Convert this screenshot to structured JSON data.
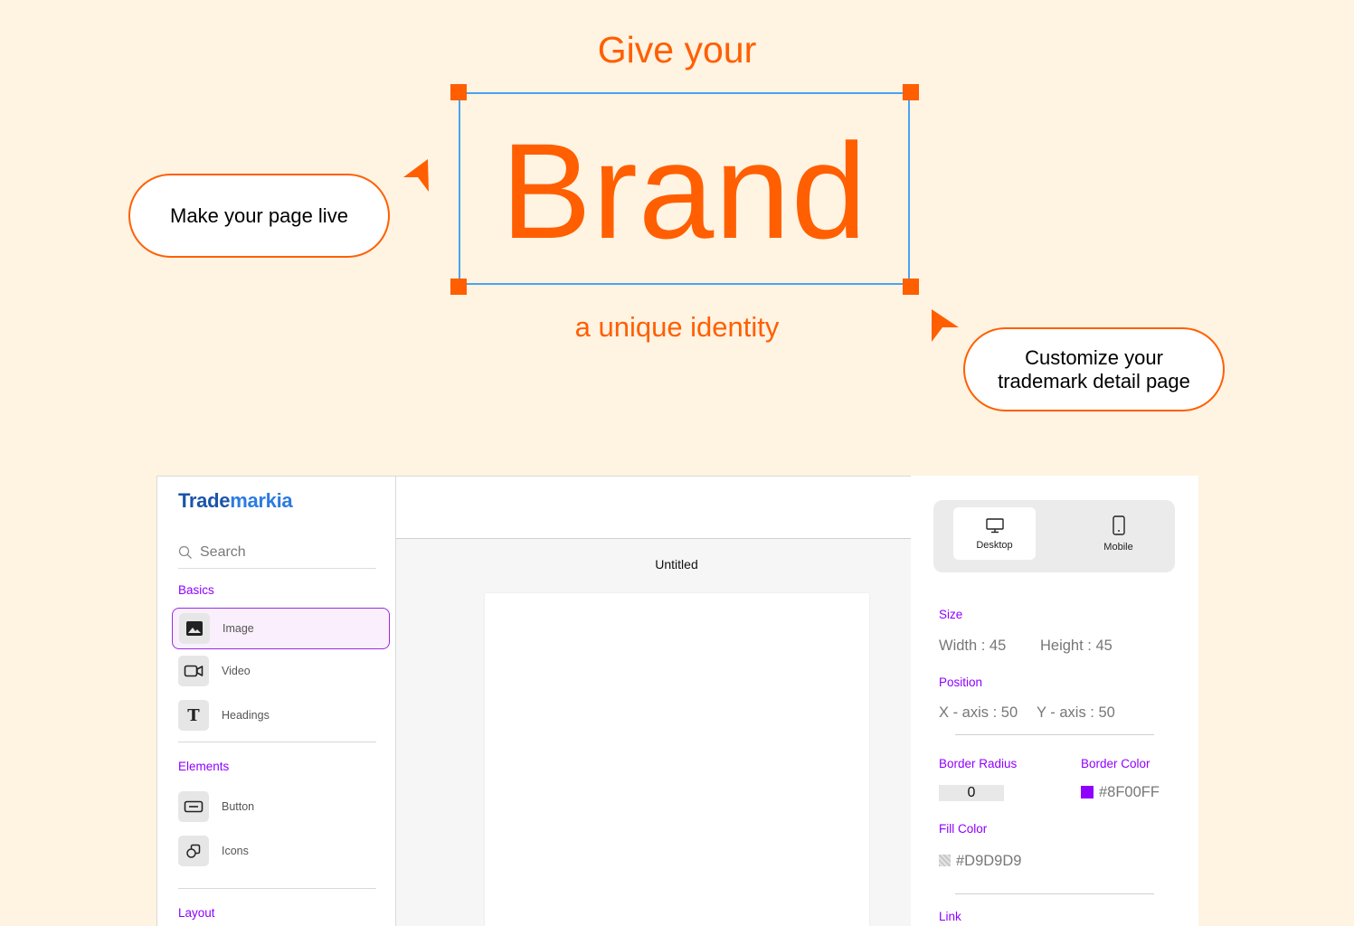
{
  "hero": {
    "top_line": "Give your",
    "brand_word": "Brand",
    "bottom_line": "a unique identity",
    "callout_left": "Make your page live",
    "callout_right": "Customize your trademark detail page",
    "accent_color": "#FF5F00",
    "selection_color": "#4AA3F0"
  },
  "app": {
    "logo": {
      "part1": "Trade",
      "part2": "markia"
    },
    "search": {
      "placeholder": "Search"
    },
    "sections": {
      "basics": "Basics",
      "elements": "Elements",
      "layout": "Layout"
    },
    "basics_items": [
      {
        "label": "Image",
        "icon": "image-icon",
        "selected": true
      },
      {
        "label": "Video",
        "icon": "video-icon"
      },
      {
        "label": "Headings",
        "icon": "heading-icon"
      }
    ],
    "elements_items": [
      {
        "label": "Button",
        "icon": "button-icon"
      },
      {
        "label": "Icons",
        "icon": "shapes-icon"
      }
    ],
    "canvas": {
      "title": "Untitled"
    },
    "devices": [
      {
        "label": "Desktop",
        "icon": "desktop-icon",
        "active": true
      },
      {
        "label": "Mobile",
        "icon": "mobile-icon"
      }
    ],
    "properties": {
      "size_label": "Size",
      "width": "Width : 45",
      "height": "Height : 45",
      "position_label": "Position",
      "x_axis": "X - axis : 50",
      "y_axis": "Y - axis : 50",
      "border_radius_label": "Border Radius",
      "border_radius_value": "0",
      "border_color_label": "Border Color",
      "border_color_value": "#8F00FF",
      "fill_color_label": "Fill Color",
      "fill_color_value": "#D9D9D9",
      "link_label": "Link"
    }
  }
}
